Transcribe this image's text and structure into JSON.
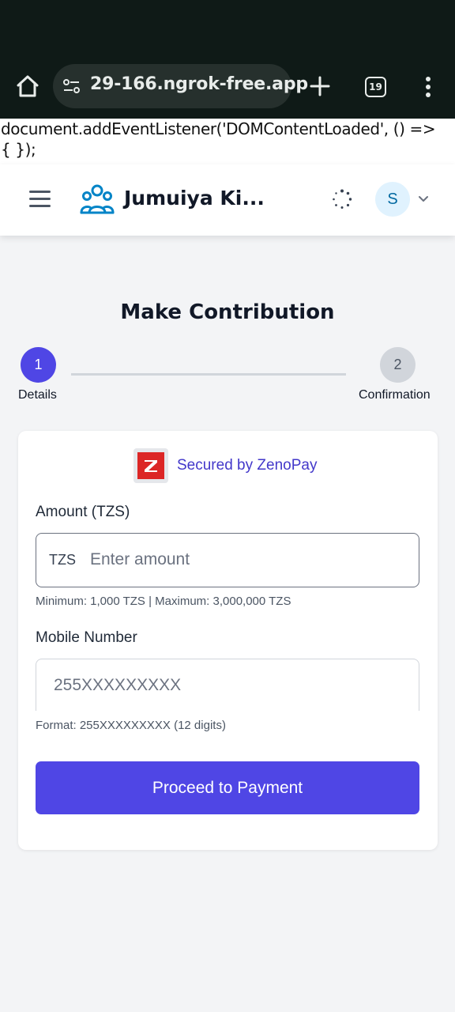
{
  "browser": {
    "url": "29-166.ngrok-free.app",
    "tab_count": "19",
    "icons": [
      "home-icon",
      "site-settings-icon",
      "new-tab-icon",
      "tab-switcher-icon",
      "more-options-icon"
    ]
  },
  "leaked_script": {
    "line1": "document.addEventListener('DOMContentLoaded', () =>",
    "line2": "{ });"
  },
  "header": {
    "brand_name": "Jumuiya Ki...",
    "avatar_initial": "S",
    "icons": [
      "menu-icon",
      "community-icon",
      "loading-icon",
      "chevron-down-icon"
    ]
  },
  "page": {
    "title": "Make Contribution"
  },
  "stepper": {
    "steps": [
      {
        "number": "1",
        "label": "Details",
        "active": true
      },
      {
        "number": "2",
        "label": "Confirmation",
        "active": false
      }
    ]
  },
  "form": {
    "secured_text": "Secured by ZenoPay",
    "logo_letter": "Z",
    "amount_label": "Amount (TZS)",
    "currency_prefix": "TZS",
    "amount_placeholder": "Enter amount",
    "amount_value": "",
    "amount_hint": "Minimum: 1,000 TZS | Maximum: 3,000,000 TZS",
    "mobile_label": "Mobile Number",
    "mobile_placeholder": "255XXXXXXXXX",
    "mobile_value": "",
    "mobile_hint": "Format: 255XXXXXXXXX (12 digits)",
    "submit_label": "Proceed to Payment"
  },
  "colors": {
    "primary": "#4f46e5",
    "secured_text": "#4338ca",
    "brand_icon": "#0284c7",
    "zenopay_logo": "#dc2626",
    "page_bg": "#f3f4f6",
    "browser_bar": "#0f1a17"
  }
}
